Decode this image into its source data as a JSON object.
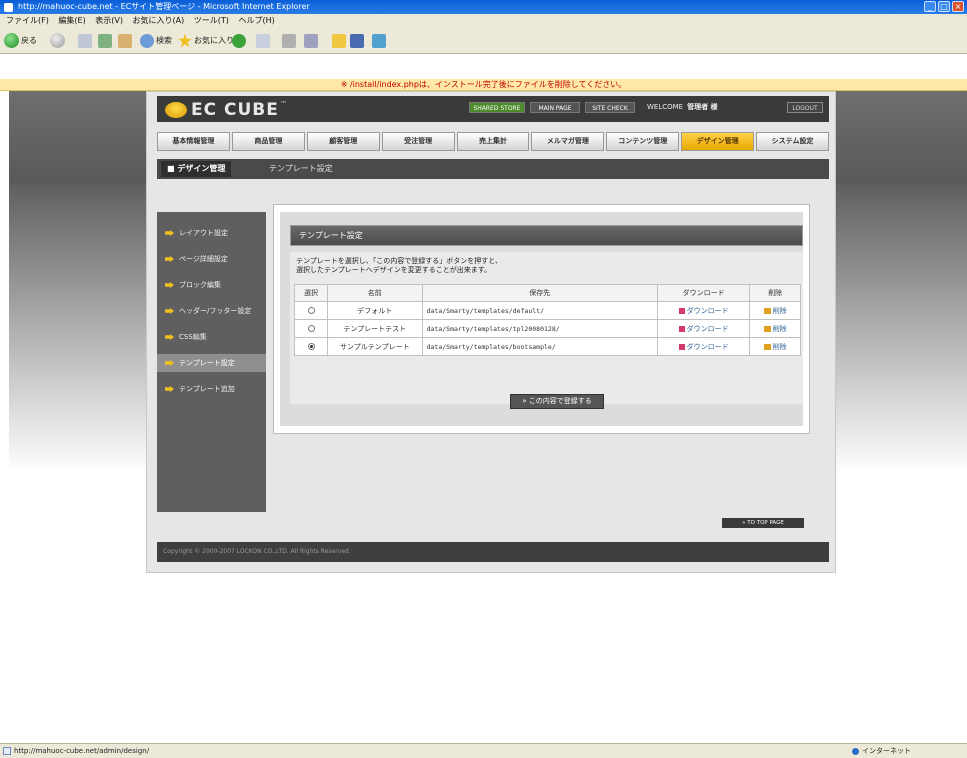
{
  "window": {
    "title": "http://mahuoc-cube.net - ECサイト管理ページ - Microsoft Internet Explorer"
  },
  "menubar": [
    "ファイル(F)",
    "編集(E)",
    "表示(V)",
    "お気に入り(A)",
    "ツール(T)",
    "ヘルプ(H)"
  ],
  "toolbar": {
    "back_label": "戻る",
    "search_label": "検索",
    "favorites_label": "お気に入り"
  },
  "warning": "※ /install/index.phpは、インストール完了後にファイルを削除してください。",
  "header": {
    "logo": "EC CUBE",
    "tm": "™",
    "btn_store": "SHARED STORE",
    "btn_main": "MAIN PAGE",
    "btn_site": "SITE CHECK",
    "welcome": "WELCOME",
    "user": "管理者 様",
    "logout": "LOGOUT"
  },
  "gnav": [
    "基本情報管理",
    "商品管理",
    "顧客管理",
    "受注管理",
    "売上集計",
    "メルマガ管理",
    "コンテンツ管理",
    "デザイン管理",
    "システム設定"
  ],
  "gnav_active_index": 7,
  "subbar": {
    "section": "デザイン管理",
    "current": "テンプレート設定"
  },
  "sidebar": [
    "レイアウト設定",
    "ページ詳細設定",
    "ブロック編集",
    "ヘッダー/フッター設定",
    "CSS編集",
    "テンプレート設定",
    "テンプレート追加"
  ],
  "sidebar_active_index": 5,
  "main": {
    "heading": "テンプレート設定",
    "description_line1": "テンプレートを選択し、「この内容で登録する」ボタンを押すと、",
    "description_line2": "選択したテンプレートへデザインを変更することが出来ます。",
    "columns": [
      "選択",
      "名前",
      "保存先",
      "ダウンロード",
      "削除"
    ],
    "rows": [
      {
        "name": "デフォルト",
        "path": "data/Smarty/templates/default/",
        "download": "ダウンロード",
        "delete": "削除",
        "selected": false
      },
      {
        "name": "テンプレートテスト",
        "path": "data/Smarty/templates/tpl20080128/",
        "download": "ダウンロード",
        "delete": "削除",
        "selected": false
      },
      {
        "name": "サンプルテンプレート",
        "path": "data/Smarty/templates/bootsample/",
        "download": "ダウンロード",
        "delete": "削除",
        "selected": true
      }
    ],
    "submit": "この内容で登録する"
  },
  "to_top": "TO TOP PAGE",
  "footer": "Copyright © 2000-2007 LOCKON CO.,LTD. All Rights Reserved.",
  "statusbar": {
    "url": "http://mahuoc-cube.net/admin/design/",
    "zone": "インターネット"
  }
}
